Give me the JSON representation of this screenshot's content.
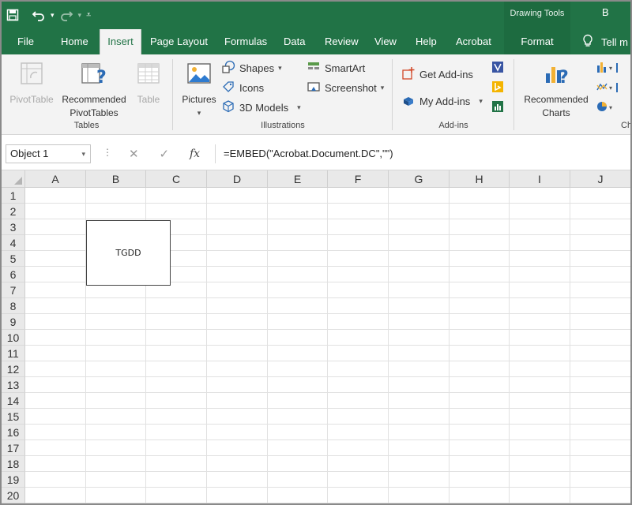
{
  "titlebar": {
    "contextual_tools": "Drawing Tools",
    "right_text": "B"
  },
  "tabs": {
    "file": "File",
    "home": "Home",
    "insert": "Insert",
    "page_layout": "Page Layout",
    "formulas": "Formulas",
    "data": "Data",
    "review": "Review",
    "view": "View",
    "help": "Help",
    "acrobat": "Acrobat",
    "format": "Format",
    "tell_me": "Tell m"
  },
  "ribbon": {
    "tables": {
      "label": "Tables",
      "pivottable": "PivotTable",
      "recommended_pivottables_line1": "Recommended",
      "recommended_pivottables_line2": "PivotTables",
      "table": "Table"
    },
    "illustrations": {
      "label": "Illustrations",
      "pictures": "Pictures",
      "shapes": "Shapes",
      "icons": "Icons",
      "models3d": "3D Models",
      "smartart": "SmartArt",
      "screenshot": "Screenshot"
    },
    "addins": {
      "label": "Add-ins",
      "get_addins": "Get Add-ins",
      "my_addins": "My Add-ins"
    },
    "charts": {
      "label": "Ch",
      "recommended_charts_line1": "Recommended",
      "recommended_charts_line2": "Charts"
    }
  },
  "formula_bar": {
    "name_box": "Object 1",
    "fx": "fx",
    "formula": "=EMBED(\"Acrobat.Document.DC\",\"\")"
  },
  "grid": {
    "columns": [
      "A",
      "B",
      "C",
      "D",
      "E",
      "F",
      "G",
      "H",
      "I",
      "J"
    ],
    "rows": [
      "1",
      "2",
      "3",
      "4",
      "5",
      "6",
      "7",
      "8",
      "9",
      "10",
      "11",
      "12",
      "13",
      "14",
      "15",
      "16",
      "17",
      "18",
      "19",
      "20"
    ]
  },
  "embedded_object": {
    "label": "TGDD"
  },
  "colors": {
    "excel_green": "#217346",
    "ribbon_bg": "#f3f3f3",
    "header_bg": "#e9e9e9"
  }
}
